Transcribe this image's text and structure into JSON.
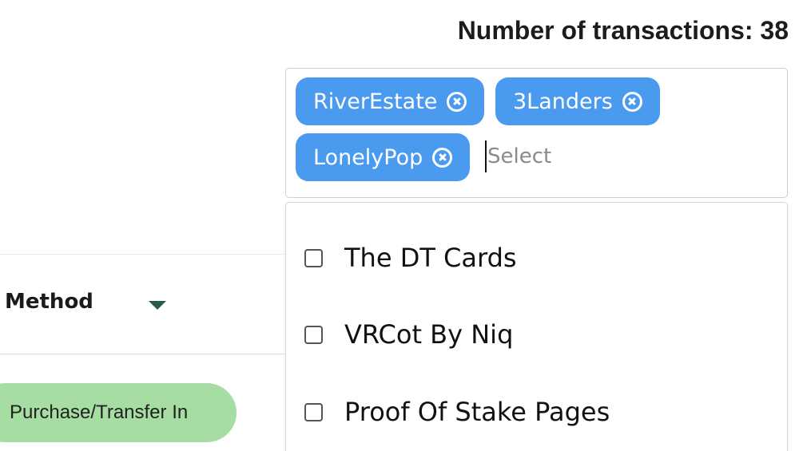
{
  "header": {
    "transactions_label": "Number of transactions: 38"
  },
  "collection_filter": {
    "selected_chips": [
      {
        "label": "RiverEstate"
      },
      {
        "label": "3Landers"
      },
      {
        "label": "LonelyPop"
      }
    ],
    "remove_icon": "close-circle-icon",
    "input_placeholder": "Select",
    "input_value": ""
  },
  "dropdown": {
    "options": [
      {
        "label": "The DT Cards",
        "checked": false
      },
      {
        "label": "VRCot By Niq",
        "checked": false
      },
      {
        "label": "Proof Of Stake Pages",
        "checked": false
      }
    ]
  },
  "table": {
    "columns": [
      {
        "label": "Method",
        "sort_icon": "triangle-down-icon"
      }
    ],
    "rows": [
      {
        "method": "Purchase/Transfer In"
      }
    ]
  },
  "colors": {
    "chip_background": "#4a9af0",
    "method_pill": "#a6dda3",
    "sort_arrow": "#2b5a4a"
  }
}
